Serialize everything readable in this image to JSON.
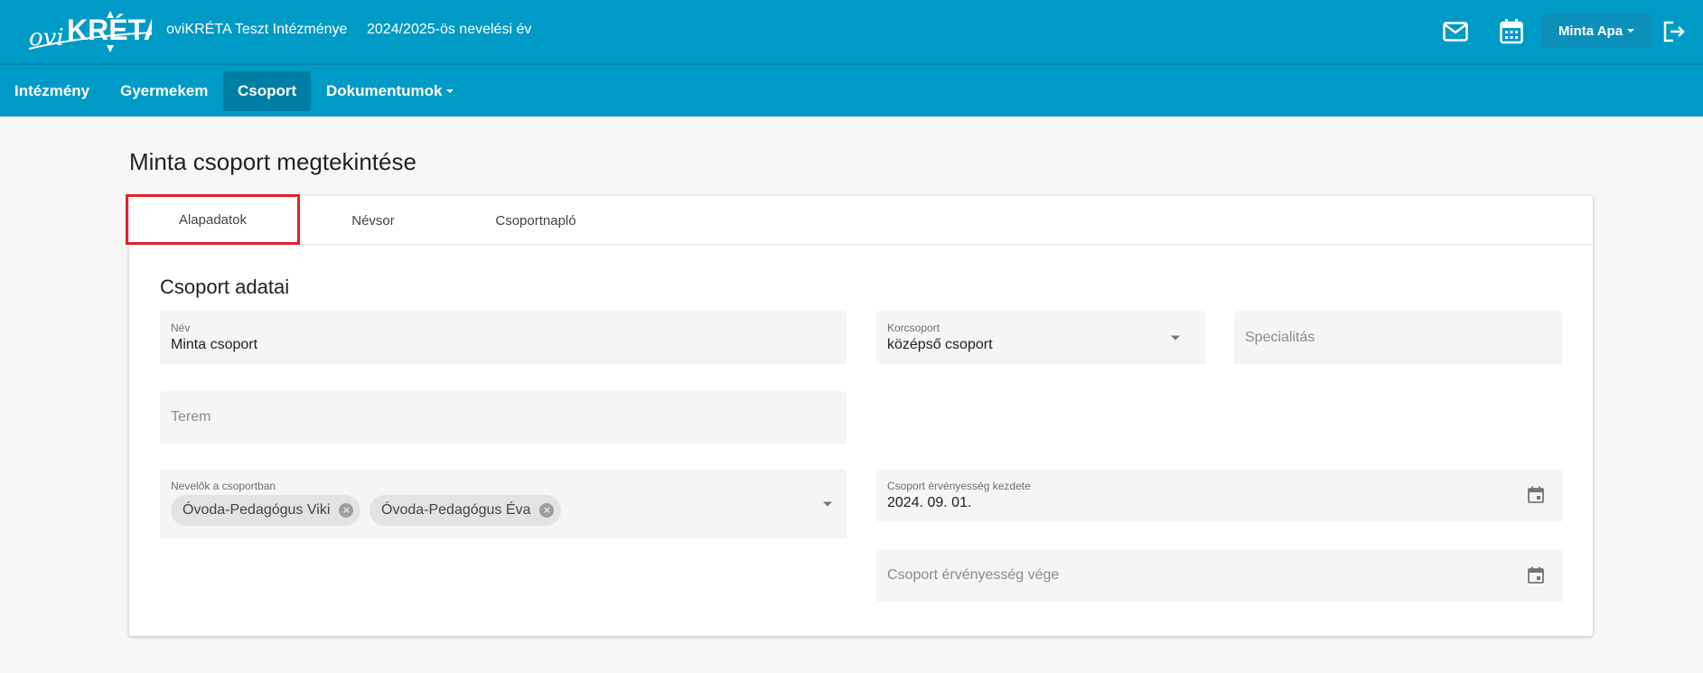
{
  "header": {
    "logo_text_prefix": "ovi",
    "logo_text_main": "KRÉTA",
    "institution": "oviKRÉTA Teszt Intézménye",
    "school_year": "2024/2025-ös nevelési év",
    "user_menu_label": "Minta Apa",
    "icons": [
      "mail-icon",
      "calendar-icon",
      "logout-icon"
    ]
  },
  "nav": {
    "items": [
      {
        "label": "Intézmény"
      },
      {
        "label": "Gyermekem"
      },
      {
        "label": "Csoport"
      },
      {
        "label": "Dokumentumok"
      }
    ],
    "active": "Csoport"
  },
  "page": {
    "title": "Minta csoport megtekintése"
  },
  "tabs": [
    {
      "label": "Alapadatok"
    },
    {
      "label": "Névsor"
    },
    {
      "label": "Csoportnapló"
    }
  ],
  "form": {
    "section_title": "Csoport adatai",
    "name": {
      "label": "Név",
      "value": "Minta csoport"
    },
    "age_group": {
      "label": "Korcsoport",
      "value": "középső csoport"
    },
    "specialty": {
      "placeholder": "Specialitás"
    },
    "room": {
      "placeholder": "Terem"
    },
    "teachers": {
      "label": "Nevelők a csoportban",
      "chips": [
        "Óvoda-Pedagógus Viki",
        "Óvoda-Pedagógus Éva"
      ]
    },
    "valid_from": {
      "label": "Csoport érvényesség kezdete",
      "value": "2024. 09. 01."
    },
    "valid_to": {
      "placeholder": "Csoport érvényesség vége"
    }
  },
  "colors": {
    "header_bg": "#009ac6",
    "nav_active_bg": "#007ea3",
    "highlight_border": "#e0222a"
  }
}
